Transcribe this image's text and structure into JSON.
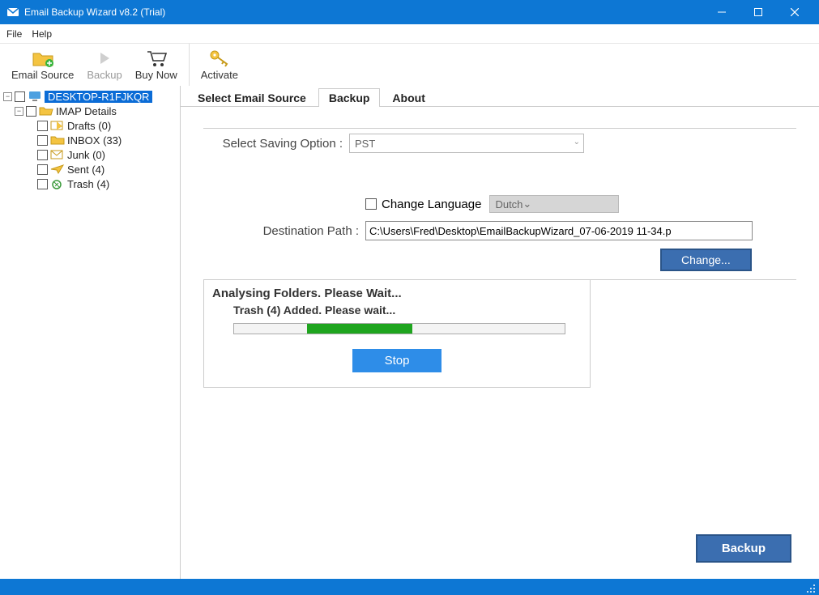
{
  "titlebar": {
    "title": "Email Backup Wizard v8.2 (Trial)"
  },
  "menubar": {
    "file": "File",
    "help": "Help"
  },
  "toolbar": {
    "email_source": "Email Source",
    "backup": "Backup",
    "buy_now": "Buy Now",
    "activate": "Activate"
  },
  "tree": {
    "root": "DESKTOP-R1FJKQR",
    "imap": "IMAP Details",
    "items": [
      "Drafts (0)",
      "INBOX (33)",
      "Junk (0)",
      "Sent (4)",
      "Trash (4)"
    ]
  },
  "tabs": {
    "select_source": "Select Email Source",
    "backup": "Backup",
    "about": "About"
  },
  "form": {
    "saving_option_label": "Select Saving Option :",
    "saving_option_value": "PST",
    "change_language_label": "Change Language",
    "language_value": "Dutch",
    "destination_label": "Destination Path :",
    "destination_value": "C:\\Users\\Fred\\Desktop\\EmailBackupWizard_07-06-2019 11-34.p",
    "change_button": "Change...",
    "backup_button": "Backup"
  },
  "progress": {
    "title": "Analysing Folders. Please Wait...",
    "sub": "Trash (4) Added. Please wait...",
    "stop": "Stop"
  }
}
